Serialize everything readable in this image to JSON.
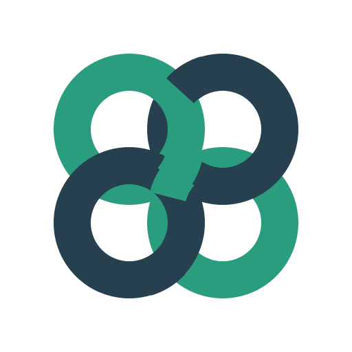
{
  "logo": {
    "icon": "interlocking-rings-cross-logo-icon",
    "colors": {
      "background": "#ffffff",
      "green": "#2a9d7f",
      "navy": "#27404f"
    }
  }
}
